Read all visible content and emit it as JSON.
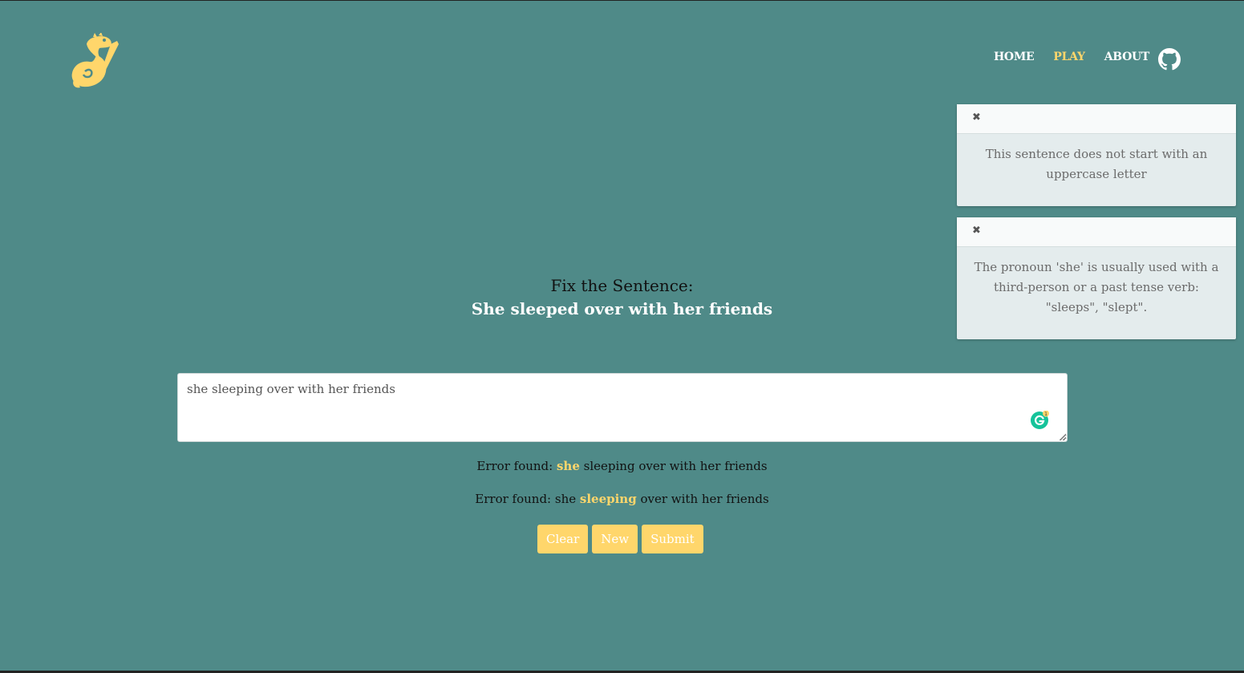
{
  "nav": {
    "items": [
      {
        "label": "HOME",
        "active": false
      },
      {
        "label": "PLAY",
        "active": true
      },
      {
        "label": "ABOUT",
        "active": false
      }
    ],
    "github_icon": "github-icon"
  },
  "logo": {
    "icon": "dinosaur-pencil-logo",
    "color": "#ffd66b"
  },
  "toasts": [
    {
      "close": "✖",
      "message": "This sentence does not start with an uppercase letter"
    },
    {
      "close": "✖",
      "message": "The pronoun 'she' is usually used with a third-person or a past tense verb: \"sleeps\", \"slept\"."
    }
  ],
  "game": {
    "title": "Fix the Sentence:",
    "sentence": "She sleeped over with her friends"
  },
  "input": {
    "value": "she sleeping over with her friends",
    "grammarly_count": "1"
  },
  "errors": [
    {
      "prefix": "Error found: ",
      "before": "",
      "highlight": "she",
      "after": " sleeping over with her friends"
    },
    {
      "prefix": "Error found: ",
      "before": "she ",
      "highlight": "sleeping",
      "after": " over with her friends"
    }
  ],
  "buttons": {
    "clear": "Clear",
    "new": "New",
    "submit": "Submit"
  },
  "colors": {
    "background": "#4f8a88",
    "accent": "#ffd66b",
    "toast_bg": "#e4eced"
  }
}
